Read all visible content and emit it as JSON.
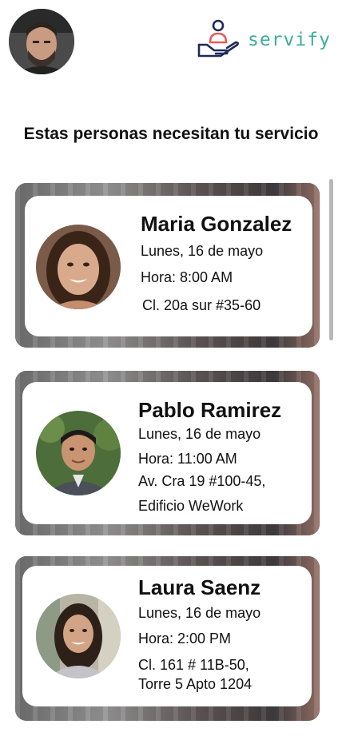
{
  "header": {
    "brand_name": "servify",
    "brand_color": "#3fae9c",
    "logo_icon": "hand-holding-person-icon",
    "user_avatar": "user-profile-photo"
  },
  "heading": "Estas personas necesitan tu servicio",
  "requests": [
    {
      "name": "Maria Gonzalez",
      "date": "Lunes, 16 de mayo",
      "time": "Hora: 8:00 AM",
      "address": "Cl. 20a sur #35-60"
    },
    {
      "name": "Pablo Ramirez",
      "date": "Lunes, 16 de mayo",
      "time": "Hora: 11:00 AM",
      "address": "Av. Cra 19 #100-45,",
      "address2": "Edificio WeWork"
    },
    {
      "name": "Laura Saenz",
      "date": "Lunes, 16 de mayo",
      "time": "Hora: 2:00 PM",
      "address": "Cl. 161 # 11B-50,",
      "address2": "Torre 5 Apto 1204"
    }
  ]
}
